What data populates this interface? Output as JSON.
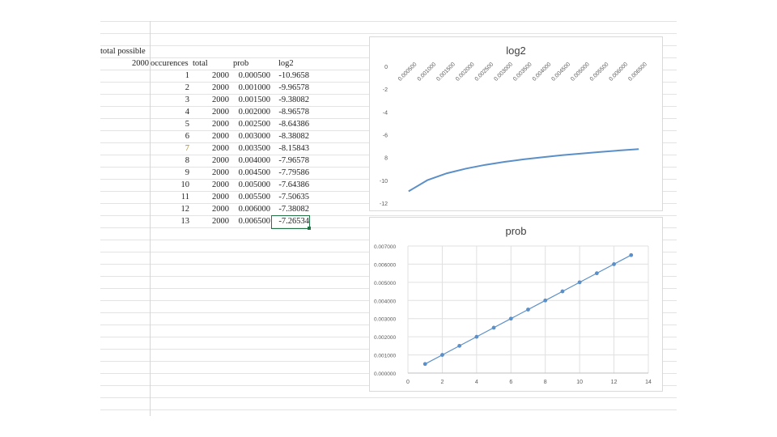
{
  "sheet": {
    "header_label": "total possible",
    "header_value": "2000",
    "columns": [
      "occurences",
      "total",
      "prob",
      "log2"
    ],
    "rows": [
      [
        "1",
        "2000",
        "0.000500",
        "-10.9658"
      ],
      [
        "2",
        "2000",
        "0.001000",
        "-9.96578"
      ],
      [
        "3",
        "2000",
        "0.001500",
        "-9.38082"
      ],
      [
        "4",
        "2000",
        "0.002000",
        "-8.96578"
      ],
      [
        "5",
        "2000",
        "0.002500",
        "-8.64386"
      ],
      [
        "6",
        "2000",
        "0.003000",
        "-8.38082"
      ],
      [
        "7",
        "2000",
        "0.003500",
        "-8.15843"
      ],
      [
        "8",
        "2000",
        "0.004000",
        "-7.96578"
      ],
      [
        "9",
        "2000",
        "0.004500",
        "-7.79586"
      ],
      [
        "10",
        "2000",
        "0.005000",
        "-7.64386"
      ],
      [
        "11",
        "2000",
        "0.005500",
        "-7.50635"
      ],
      [
        "12",
        "2000",
        "0.006000",
        "-7.38082"
      ],
      [
        "13",
        "2000",
        "0.006500",
        "-7.26534"
      ]
    ],
    "colors": {
      "grid": "#e3e3e3",
      "selection": "#217346",
      "row7_text": "#b08a00"
    }
  },
  "chart_data": [
    {
      "type": "line",
      "title": "log2",
      "xlabel": "",
      "ylabel": "",
      "categories": [
        "0.000500",
        "0.001000",
        "0.001500",
        "0.002000",
        "0.002500",
        "0.003000",
        "0.003500",
        "0.004000",
        "0.004500",
        "0.005000",
        "0.005500",
        "0.006000",
        "0.006500"
      ],
      "series": [
        {
          "values": [
            -10.9658,
            -9.96578,
            -9.38082,
            -8.96578,
            -8.64386,
            -8.38082,
            -8.15843,
            -7.96578,
            -7.79586,
            -7.64386,
            -7.50635,
            -7.38082,
            -7.26534
          ]
        }
      ],
      "ylim": [
        -12,
        0
      ],
      "yticks": [
        0,
        -2,
        -4,
        -6,
        -8,
        -10,
        -12
      ],
      "ytick_labels": [
        "0",
        "-2",
        "-4",
        "-6",
        "8",
        "-10",
        "-12"
      ],
      "x_axis_position": "top",
      "grid": false,
      "color": "#5b8fc7"
    },
    {
      "type": "scatter",
      "title": "prob",
      "xlabel": "",
      "ylabel": "",
      "x": [
        1,
        2,
        3,
        4,
        5,
        6,
        7,
        8,
        9,
        10,
        11,
        12,
        13
      ],
      "series": [
        {
          "values": [
            0.0005,
            0.001,
            0.0015,
            0.002,
            0.0025,
            0.003,
            0.0035,
            0.004,
            0.0045,
            0.005,
            0.0055,
            0.006,
            0.0065
          ]
        }
      ],
      "xlim": [
        0,
        14
      ],
      "xticks": [
        0,
        2,
        4,
        6,
        8,
        10,
        12,
        14
      ],
      "ylim": [
        0,
        0.007
      ],
      "yticks": [
        0,
        0.001,
        0.002,
        0.003,
        0.004,
        0.005,
        0.006,
        0.007
      ],
      "ytick_labels": [
        "0.000000",
        "0.001000",
        "0.002000",
        "0.003000",
        "0.004000",
        "0.005000",
        "0.006000",
        "0.007000"
      ],
      "lines_connected": true,
      "grid": true,
      "color": "#5b8fc7"
    }
  ]
}
